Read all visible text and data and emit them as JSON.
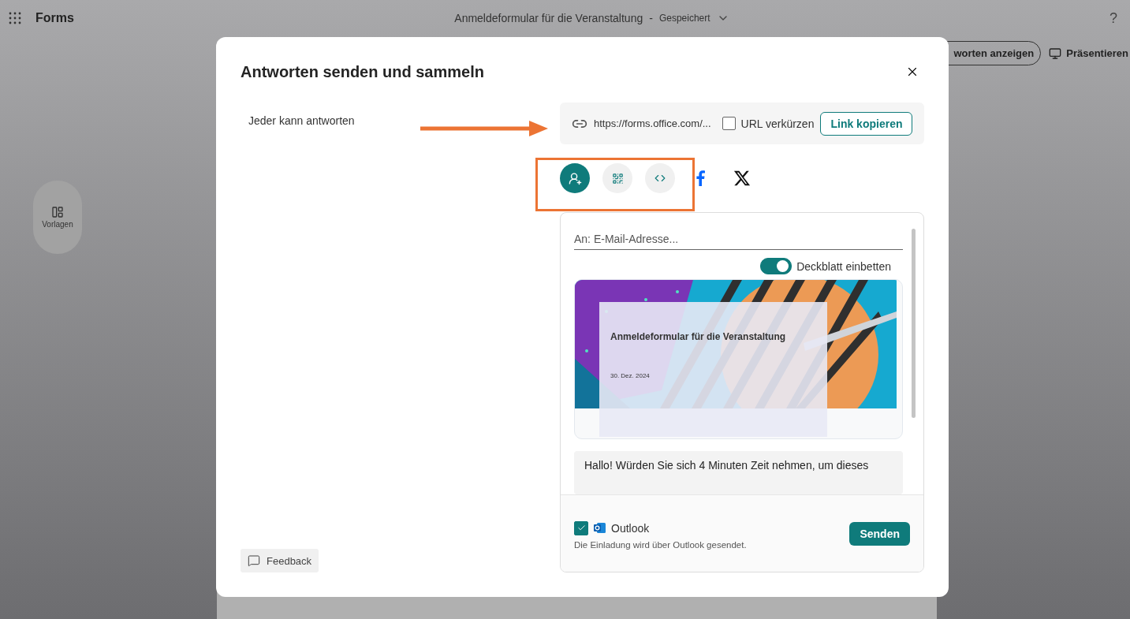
{
  "app_bar": {
    "app_name": "Forms",
    "document_title": "Anmeldeformular für die Veranstaltung",
    "separator": "-",
    "save_status": "Gespeichert",
    "help": "?"
  },
  "toolbar": {
    "buttons": [
      {
        "kind": "outline",
        "label": "worten anzeigen"
      },
      {
        "kind": "present",
        "label": "Präsentieren"
      }
    ]
  },
  "side_rail": {
    "items": [
      {
        "label": "Vorlagen"
      }
    ]
  },
  "dialog": {
    "title": "Antworten senden und sammeln",
    "audience": "Jeder kann antworten",
    "link": {
      "url": "https://forms.office.com/...",
      "shorten": {
        "label": "URL verkürzen",
        "checked": false
      },
      "copy_button": "Link kopieren"
    },
    "share_methods": [
      {
        "kind": "invite",
        "selected": true
      },
      {
        "kind": "qr",
        "selected": false
      },
      {
        "kind": "embed",
        "selected": false
      }
    ],
    "social": [
      {
        "kind": "facebook"
      },
      {
        "kind": "x"
      }
    ],
    "email": {
      "placeholder": "An: E-Mail-Adresse..."
    },
    "cover_toggle": {
      "label": "Deckblatt einbetten",
      "on": true
    },
    "cover": {
      "kind": "picture",
      "title": "Anmeldeformular für die Veranstaltung",
      "date": "30. Dez. 2024"
    },
    "message": "Hallo! Würden Sie sich 4 Minuten Zeit nehmen, um dieses",
    "outlook": {
      "checked": true,
      "label": "Outlook",
      "caption": "Die Einladung wird über Outlook gesendet."
    },
    "send_button": "Senden",
    "feedback": "Feedback"
  }
}
